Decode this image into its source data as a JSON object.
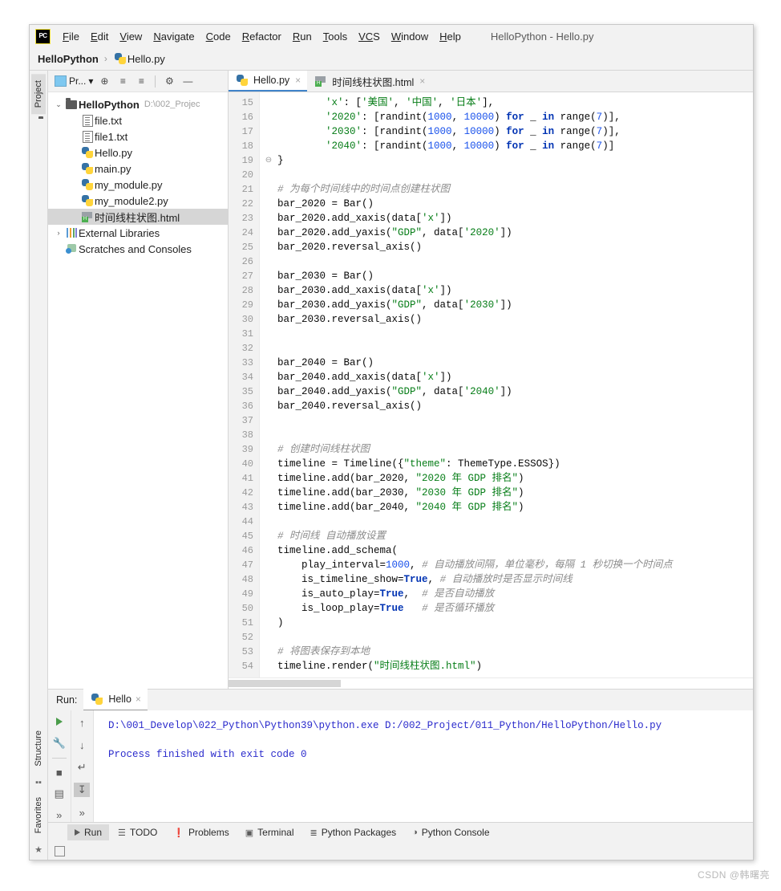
{
  "window": {
    "title": "HelloPython - Hello.py",
    "logo_text": "PC"
  },
  "menubar": {
    "items": [
      {
        "label": "File",
        "mnemonic": "F",
        "rest": "ile"
      },
      {
        "label": "Edit",
        "mnemonic": "E",
        "rest": "dit"
      },
      {
        "label": "View",
        "mnemonic": "V",
        "rest": "iew"
      },
      {
        "label": "Navigate",
        "mnemonic": "N",
        "rest": "avigate"
      },
      {
        "label": "Code",
        "mnemonic": "C",
        "rest": "ode"
      },
      {
        "label": "Refactor",
        "mnemonic": "R",
        "rest": "efactor"
      },
      {
        "label": "Run",
        "mnemonic": "R",
        "rest": "un"
      },
      {
        "label": "Tools",
        "mnemonic": "T",
        "rest": "ools"
      },
      {
        "label": "VCS",
        "mnemonic": "VC",
        "rest": "S"
      },
      {
        "label": "Window",
        "mnemonic": "W",
        "rest": "indow"
      },
      {
        "label": "Help",
        "mnemonic": "H",
        "rest": "elp"
      }
    ]
  },
  "breadcrumb": {
    "project": "HelloPython",
    "separator": "›",
    "file": "Hello.py"
  },
  "left_strip": {
    "project_tab": "Project"
  },
  "bottom_left_strip": {
    "structure_tab": "Structure",
    "favorites_tab": "Favorites"
  },
  "project_pane": {
    "toolbar": {
      "selector_label": "Pr...",
      "selector_caret": "▾",
      "locate_icon": "⊕",
      "expand_all_icon": "≡",
      "collapse_all_icon": "≡",
      "settings_icon": "⚙",
      "hide_icon": "—"
    },
    "tree": [
      {
        "label": "HelloPython",
        "path": "D:\\002_Projec",
        "icon": "folder-icon",
        "indent": 0,
        "arrow": "⌄",
        "bold": true,
        "selected": false
      },
      {
        "label": "file.txt",
        "path": "",
        "icon": "txt-file-icon",
        "indent": 1,
        "arrow": "",
        "bold": false,
        "selected": false
      },
      {
        "label": "file1.txt",
        "path": "",
        "icon": "txt-file-icon",
        "indent": 1,
        "arrow": "",
        "bold": false,
        "selected": false
      },
      {
        "label": "Hello.py",
        "path": "",
        "icon": "python-file-icon",
        "indent": 1,
        "arrow": "",
        "bold": false,
        "selected": false
      },
      {
        "label": "main.py",
        "path": "",
        "icon": "python-file-icon",
        "indent": 1,
        "arrow": "",
        "bold": false,
        "selected": false
      },
      {
        "label": "my_module.py",
        "path": "",
        "icon": "python-file-icon",
        "indent": 1,
        "arrow": "",
        "bold": false,
        "selected": false
      },
      {
        "label": "my_module2.py",
        "path": "",
        "icon": "python-file-icon",
        "indent": 1,
        "arrow": "",
        "bold": false,
        "selected": false
      },
      {
        "label": "时间线柱状图.html",
        "path": "",
        "icon": "html-file-icon",
        "indent": 1,
        "arrow": "",
        "bold": false,
        "selected": true
      },
      {
        "label": "External Libraries",
        "path": "",
        "icon": "library-icon",
        "indent": 0,
        "arrow": "›",
        "bold": false,
        "selected": false
      },
      {
        "label": "Scratches and Consoles",
        "path": "",
        "icon": "scratches-icon",
        "indent": 0,
        "arrow": "",
        "bold": false,
        "selected": false
      }
    ]
  },
  "editor": {
    "tabs": [
      {
        "label": "Hello.py",
        "icon": "python-file-icon",
        "active": true,
        "close": "×"
      },
      {
        "label": "时间线柱状图.html",
        "icon": "html-file-icon",
        "active": false,
        "close": "×"
      }
    ],
    "first_line_number": 15,
    "lines": [
      {
        "n": 15,
        "fold": "",
        "tokens": [
          {
            "t": "        ",
            "c": ""
          },
          {
            "t": "'x'",
            "c": "str"
          },
          {
            "t": ": [",
            "c": ""
          },
          {
            "t": "'美国'",
            "c": "str"
          },
          {
            "t": ", ",
            "c": ""
          },
          {
            "t": "'中国'",
            "c": "str"
          },
          {
            "t": ", ",
            "c": ""
          },
          {
            "t": "'日本'",
            "c": "str"
          },
          {
            "t": "],",
            "c": ""
          }
        ]
      },
      {
        "n": 16,
        "fold": "",
        "tokens": [
          {
            "t": "        ",
            "c": ""
          },
          {
            "t": "'2020'",
            "c": "str"
          },
          {
            "t": ": [randint(",
            "c": ""
          },
          {
            "t": "1000",
            "c": "num"
          },
          {
            "t": ", ",
            "c": ""
          },
          {
            "t": "10000",
            "c": "num"
          },
          {
            "t": ") ",
            "c": ""
          },
          {
            "t": "for",
            "c": "kw"
          },
          {
            "t": " _ ",
            "c": ""
          },
          {
            "t": "in",
            "c": "kw"
          },
          {
            "t": " range(",
            "c": ""
          },
          {
            "t": "7",
            "c": "num"
          },
          {
            "t": ")],",
            "c": ""
          }
        ]
      },
      {
        "n": 17,
        "fold": "",
        "tokens": [
          {
            "t": "        ",
            "c": ""
          },
          {
            "t": "'2030'",
            "c": "str"
          },
          {
            "t": ": [randint(",
            "c": ""
          },
          {
            "t": "1000",
            "c": "num"
          },
          {
            "t": ", ",
            "c": ""
          },
          {
            "t": "10000",
            "c": "num"
          },
          {
            "t": ") ",
            "c": ""
          },
          {
            "t": "for",
            "c": "kw"
          },
          {
            "t": " _ ",
            "c": ""
          },
          {
            "t": "in",
            "c": "kw"
          },
          {
            "t": " range(",
            "c": ""
          },
          {
            "t": "7",
            "c": "num"
          },
          {
            "t": ")],",
            "c": ""
          }
        ]
      },
      {
        "n": 18,
        "fold": "",
        "tokens": [
          {
            "t": "        ",
            "c": ""
          },
          {
            "t": "'2040'",
            "c": "str"
          },
          {
            "t": ": [randint(",
            "c": ""
          },
          {
            "t": "1000",
            "c": "num"
          },
          {
            "t": ", ",
            "c": ""
          },
          {
            "t": "10000",
            "c": "num"
          },
          {
            "t": ") ",
            "c": ""
          },
          {
            "t": "for",
            "c": "kw"
          },
          {
            "t": " _ ",
            "c": ""
          },
          {
            "t": "in",
            "c": "kw"
          },
          {
            "t": " range(",
            "c": ""
          },
          {
            "t": "7",
            "c": "num"
          },
          {
            "t": ")]",
            "c": ""
          }
        ]
      },
      {
        "n": 19,
        "fold": "⊖",
        "tokens": [
          {
            "t": "}",
            "c": ""
          }
        ]
      },
      {
        "n": 20,
        "fold": "",
        "tokens": []
      },
      {
        "n": 21,
        "fold": "",
        "tokens": [
          {
            "t": "# 为每个时间线中的时间点创建柱状图",
            "c": "cmt"
          }
        ]
      },
      {
        "n": 22,
        "fold": "",
        "tokens": [
          {
            "t": "bar_2020 = Bar()",
            "c": ""
          }
        ]
      },
      {
        "n": 23,
        "fold": "",
        "tokens": [
          {
            "t": "bar_2020.add_xaxis(data[",
            "c": ""
          },
          {
            "t": "'x'",
            "c": "str"
          },
          {
            "t": "])",
            "c": ""
          }
        ]
      },
      {
        "n": 24,
        "fold": "",
        "tokens": [
          {
            "t": "bar_2020.add_yaxis(",
            "c": ""
          },
          {
            "t": "\"GDP\"",
            "c": "str"
          },
          {
            "t": ", data[",
            "c": ""
          },
          {
            "t": "'2020'",
            "c": "str"
          },
          {
            "t": "])",
            "c": ""
          }
        ]
      },
      {
        "n": 25,
        "fold": "",
        "tokens": [
          {
            "t": "bar_2020.reversal_axis()",
            "c": ""
          }
        ]
      },
      {
        "n": 26,
        "fold": "",
        "tokens": []
      },
      {
        "n": 27,
        "fold": "",
        "tokens": [
          {
            "t": "bar_2030 = Bar()",
            "c": ""
          }
        ]
      },
      {
        "n": 28,
        "fold": "",
        "tokens": [
          {
            "t": "bar_2030.add_xaxis(data[",
            "c": ""
          },
          {
            "t": "'x'",
            "c": "str"
          },
          {
            "t": "])",
            "c": ""
          }
        ]
      },
      {
        "n": 29,
        "fold": "",
        "tokens": [
          {
            "t": "bar_2030.add_yaxis(",
            "c": ""
          },
          {
            "t": "\"GDP\"",
            "c": "str"
          },
          {
            "t": ", data[",
            "c": ""
          },
          {
            "t": "'2030'",
            "c": "str"
          },
          {
            "t": "])",
            "c": ""
          }
        ]
      },
      {
        "n": 30,
        "fold": "",
        "tokens": [
          {
            "t": "bar_2030.reversal_axis()",
            "c": ""
          }
        ]
      },
      {
        "n": 31,
        "fold": "",
        "tokens": []
      },
      {
        "n": 32,
        "fold": "",
        "tokens": []
      },
      {
        "n": 33,
        "fold": "",
        "tokens": [
          {
            "t": "bar_2040 = Bar()",
            "c": ""
          }
        ]
      },
      {
        "n": 34,
        "fold": "",
        "tokens": [
          {
            "t": "bar_2040.add_xaxis(data[",
            "c": ""
          },
          {
            "t": "'x'",
            "c": "str"
          },
          {
            "t": "])",
            "c": ""
          }
        ]
      },
      {
        "n": 35,
        "fold": "",
        "tokens": [
          {
            "t": "bar_2040.add_yaxis(",
            "c": ""
          },
          {
            "t": "\"GDP\"",
            "c": "str"
          },
          {
            "t": ", data[",
            "c": ""
          },
          {
            "t": "'2040'",
            "c": "str"
          },
          {
            "t": "])",
            "c": ""
          }
        ]
      },
      {
        "n": 36,
        "fold": "",
        "tokens": [
          {
            "t": "bar_2040.reversal_axis()",
            "c": ""
          }
        ]
      },
      {
        "n": 37,
        "fold": "",
        "tokens": []
      },
      {
        "n": 38,
        "fold": "",
        "tokens": []
      },
      {
        "n": 39,
        "fold": "",
        "tokens": [
          {
            "t": "# 创建时间线柱状图",
            "c": "cmt"
          }
        ]
      },
      {
        "n": 40,
        "fold": "",
        "tokens": [
          {
            "t": "timeline = Timeline({",
            "c": ""
          },
          {
            "t": "\"theme\"",
            "c": "str"
          },
          {
            "t": ": ThemeType.ESSOS})",
            "c": ""
          }
        ]
      },
      {
        "n": 41,
        "fold": "",
        "tokens": [
          {
            "t": "timeline.add(bar_2020, ",
            "c": ""
          },
          {
            "t": "\"2020 年 GDP 排名\"",
            "c": "str"
          },
          {
            "t": ")",
            "c": ""
          }
        ]
      },
      {
        "n": 42,
        "fold": "",
        "tokens": [
          {
            "t": "timeline.add(bar_2030, ",
            "c": ""
          },
          {
            "t": "\"2030 年 GDP 排名\"",
            "c": "str"
          },
          {
            "t": ")",
            "c": ""
          }
        ]
      },
      {
        "n": 43,
        "fold": "",
        "tokens": [
          {
            "t": "timeline.add(bar_2040, ",
            "c": ""
          },
          {
            "t": "\"2040 年 GDP 排名\"",
            "c": "str"
          },
          {
            "t": ")",
            "c": ""
          }
        ]
      },
      {
        "n": 44,
        "fold": "",
        "tokens": []
      },
      {
        "n": 45,
        "fold": "",
        "tokens": [
          {
            "t": "# 时间线 自动播放设置",
            "c": "cmt"
          }
        ]
      },
      {
        "n": 46,
        "fold": "",
        "tokens": [
          {
            "t": "timeline.add_schema(",
            "c": ""
          }
        ]
      },
      {
        "n": 47,
        "fold": "",
        "tokens": [
          {
            "t": "    play_interval=",
            "c": ""
          },
          {
            "t": "1000",
            "c": "num"
          },
          {
            "t": ", ",
            "c": ""
          },
          {
            "t": "# 自动播放间隔，单位毫秒，每隔 1 秒切换一个时间点",
            "c": "cmt"
          }
        ]
      },
      {
        "n": 48,
        "fold": "",
        "tokens": [
          {
            "t": "    is_timeline_show=",
            "c": ""
          },
          {
            "t": "True",
            "c": "kw"
          },
          {
            "t": ", ",
            "c": ""
          },
          {
            "t": "# 自动播放时是否显示时间线",
            "c": "cmt"
          }
        ]
      },
      {
        "n": 49,
        "fold": "",
        "tokens": [
          {
            "t": "    is_auto_play=",
            "c": ""
          },
          {
            "t": "True",
            "c": "kw"
          },
          {
            "t": ",  ",
            "c": ""
          },
          {
            "t": "# 是否自动播放",
            "c": "cmt"
          }
        ]
      },
      {
        "n": 50,
        "fold": "",
        "tokens": [
          {
            "t": "    is_loop_play=",
            "c": ""
          },
          {
            "t": "True",
            "c": "kw"
          },
          {
            "t": "   ",
            "c": ""
          },
          {
            "t": "# 是否循环播放",
            "c": "cmt"
          }
        ]
      },
      {
        "n": 51,
        "fold": "",
        "tokens": [
          {
            "t": ")",
            "c": ""
          }
        ]
      },
      {
        "n": 52,
        "fold": "",
        "tokens": []
      },
      {
        "n": 53,
        "fold": "",
        "tokens": [
          {
            "t": "# 将图表保存到本地",
            "c": "cmt"
          }
        ]
      },
      {
        "n": 54,
        "fold": "",
        "tokens": [
          {
            "t": "timeline.render(",
            "c": ""
          },
          {
            "t": "\"时间线柱状图.html\"",
            "c": "str"
          },
          {
            "t": ")",
            "c": ""
          }
        ]
      }
    ]
  },
  "run_panel": {
    "label": "Run:",
    "tab_label": "Hello",
    "tab_close": "×",
    "gutter": {
      "rerun_icon": "▶",
      "settings_icon": "🔧",
      "stop_icon": "■",
      "layout_icon": "▤",
      "more_icon": "»",
      "up_icon": "↑",
      "down_icon": "↓",
      "soft_wrap_icon": "↵",
      "scroll_end_icon": "↧",
      "more_icon2": "»"
    },
    "console_lines": [
      "D:\\001_Develop\\022_Python\\Python39\\python.exe D:/002_Project/011_Python/HelloPython/Hello.py",
      "",
      "Process finished with exit code 0"
    ]
  },
  "bottom_bar": {
    "items": [
      {
        "label": "Run",
        "icon": "play-icon",
        "glyph": "▶",
        "active": true
      },
      {
        "label": "TODO",
        "icon": "todo-list-icon",
        "glyph": "☰",
        "active": false
      },
      {
        "label": "Problems",
        "icon": "problems-icon",
        "glyph": "❗",
        "active": false
      },
      {
        "label": "Terminal",
        "icon": "terminal-icon",
        "glyph": "▣",
        "active": false
      },
      {
        "label": "Python Packages",
        "icon": "packages-icon",
        "glyph": "≣",
        "active": false
      },
      {
        "label": "Python Console",
        "icon": "python-console-icon",
        "glyph": "◑",
        "active": false
      }
    ]
  },
  "watermark": {
    "text": "CSDN @韩曙亮"
  },
  "colors": {
    "accent_blue": "#4083c9",
    "string_green": "#067d17",
    "keyword_blue": "#0033b3",
    "number_blue": "#1750eb",
    "comment_gray": "#8c8c8c",
    "console_blue": "#2b2bcc",
    "selection_gray": "#d6d6d6"
  }
}
